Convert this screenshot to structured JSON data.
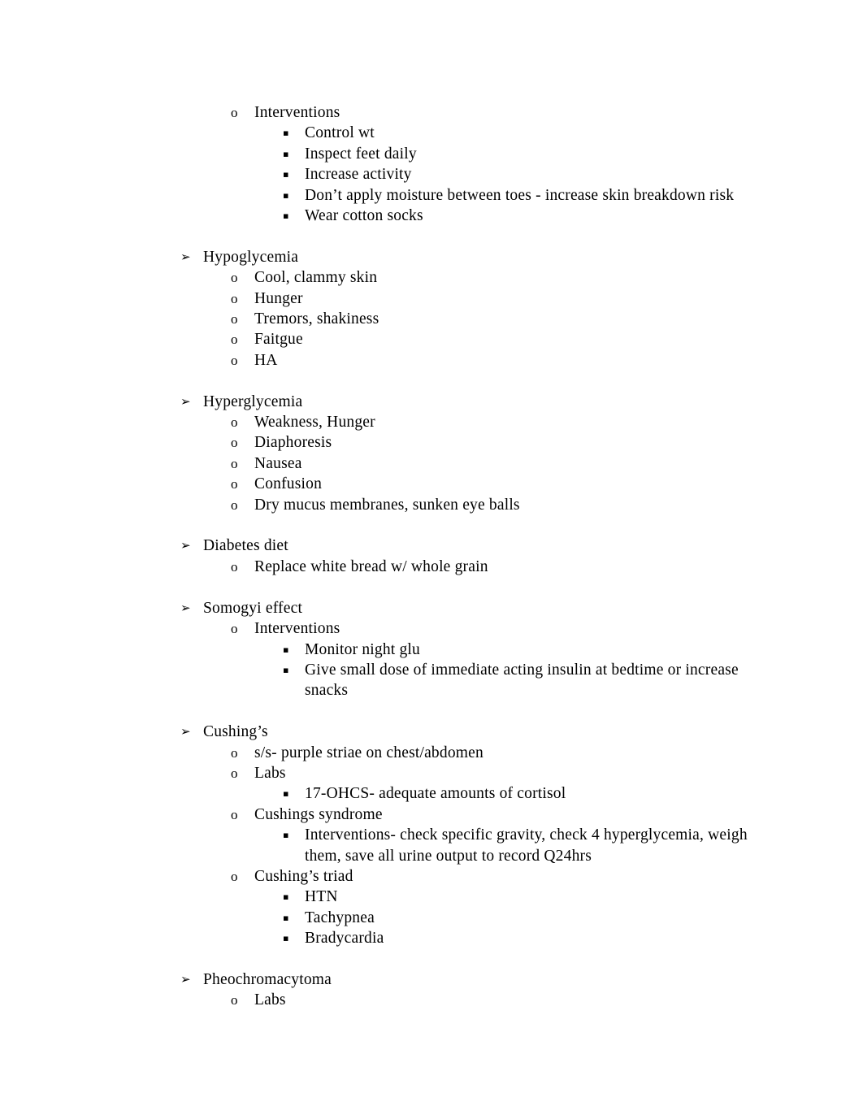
{
  "document": {
    "markers": {
      "level1": "➢",
      "level2": "o",
      "level3": "▪"
    },
    "blocks": [
      {
        "items": [
          {
            "level": 2,
            "text": "Interventions"
          },
          {
            "level": 3,
            "text": "Control wt"
          },
          {
            "level": 3,
            "text": "Inspect feet daily"
          },
          {
            "level": 3,
            "text": "Increase activity"
          },
          {
            "level": 3,
            "text": "Don’t apply moisture between toes - increase skin breakdown risk"
          },
          {
            "level": 3,
            "text": "Wear cotton socks"
          }
        ]
      },
      {
        "items": [
          {
            "level": 1,
            "text": "Hypoglycemia"
          },
          {
            "level": 2,
            "text": "Cool, clammy skin"
          },
          {
            "level": 2,
            "text": "Hunger"
          },
          {
            "level": 2,
            "text": "Tremors, shakiness"
          },
          {
            "level": 2,
            "text": "Faitgue"
          },
          {
            "level": 2,
            "text": "HA"
          }
        ]
      },
      {
        "items": [
          {
            "level": 1,
            "text": "Hyperglycemia"
          },
          {
            "level": 2,
            "text": "Weakness, Hunger"
          },
          {
            "level": 2,
            "text": "Diaphoresis"
          },
          {
            "level": 2,
            "text": "Nausea"
          },
          {
            "level": 2,
            "text": "Confusion"
          },
          {
            "level": 2,
            "text": "Dry mucus membranes, sunken eye balls"
          }
        ]
      },
      {
        "items": [
          {
            "level": 1,
            "text": "Diabetes diet"
          },
          {
            "level": 2,
            "text": "Replace white bread w/ whole grain"
          }
        ]
      },
      {
        "items": [
          {
            "level": 1,
            "text": "Somogyi effect"
          },
          {
            "level": 2,
            "text": "Interventions"
          },
          {
            "level": 3,
            "text": "Monitor night glu"
          },
          {
            "level": 3,
            "text": "Give small dose of immediate acting insulin at bedtime or increase snacks"
          }
        ]
      },
      {
        "items": [
          {
            "level": 1,
            "text": "Cushing’s"
          },
          {
            "level": 2,
            "text": "s/s- purple striae on chest/abdomen"
          },
          {
            "level": 2,
            "text": "Labs"
          },
          {
            "level": 3,
            "text": "17-OHCS- adequate amounts of cortisol"
          },
          {
            "level": 2,
            "text": "Cushings syndrome"
          },
          {
            "level": 3,
            "text": "Interventions- check specific gravity, check 4 hyperglycemia, weigh them, save all urine output to record Q24hrs"
          },
          {
            "level": 2,
            "text": "Cushing’s triad"
          },
          {
            "level": 3,
            "text": "HTN"
          },
          {
            "level": 3,
            "text": "Tachypnea"
          },
          {
            "level": 3,
            "text": "Bradycardia"
          }
        ]
      },
      {
        "items": [
          {
            "level": 1,
            "text": "Pheochromacytoma"
          },
          {
            "level": 2,
            "text": "Labs"
          }
        ]
      }
    ]
  }
}
